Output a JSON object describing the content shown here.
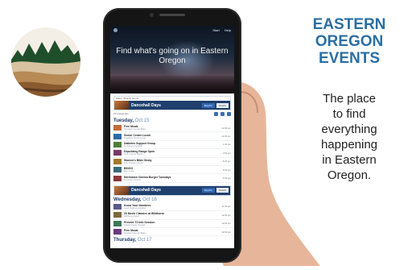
{
  "logo_icon": "forest-landscape-icon",
  "app": {
    "brand": "",
    "nav": [
      "Start",
      "Help"
    ],
    "hero_title": "Find what's going on in Eastern Oregon"
  },
  "featured": {
    "bar_label": "Sales: Shopify Gems",
    "title": "Dancehall Days",
    "primary_button": "Buy/Tix",
    "secondary_button": "Details"
  },
  "toolbar_label": "All Categories",
  "days": [
    {
      "label": "Tuesday,",
      "date": "Oct 15",
      "events": [
        {
          "title": "Free Meals",
          "sub": "Sandwich Sunrise Baker...",
          "time": "12:00 pm"
        },
        {
          "title": "Senior Center Lunch",
          "sub": "Pendleton Senior Center",
          "time": "12:00 pm"
        },
        {
          "title": "Diabetes Support Group",
          "sub": "St. Anthony Hospital",
          "time": "1:00 pm"
        },
        {
          "title": "Deputizing Range Open",
          "sub": "Union County Sheriff",
          "time": "3:00 pm"
        },
        {
          "title": "Women's Bible Study",
          "sub": "First Christian Church",
          "time": "6:00 pm"
        },
        {
          "title": "BINGO",
          "sub": "Elks Lodge",
          "time": "6:00 pm"
        },
        {
          "title": "Hermiston Cinema Burger Tuesdays",
          "sub": "Hermiston Cinema",
          "time": "6:00 pm"
        }
      ]
    },
    {
      "label": "Wednesday,",
      "date": "Oct 16",
      "events": [
        {
          "title": "Know Your Numbers",
          "sub": "Good Shepherd Medical",
          "time": "11:00 am"
        },
        {
          "title": "20 Movie Classics at Wildhorse",
          "sub": "Wildhorse Resort",
          "time": "12:00 pm"
        },
        {
          "title": "Prevent T2 Info Session",
          "sub": "Grande Ronde Hospital",
          "time": "12:00 pm"
        },
        {
          "title": "Free Meals",
          "sub": "Sandwich Sunrise Baker...",
          "time": "12:00 pm"
        }
      ]
    },
    {
      "label": "Thursday,",
      "date": "Oct 17",
      "events": []
    }
  ],
  "heading": [
    "EASTERN",
    "OREGON",
    "EVENTS"
  ],
  "tagline": [
    "The place",
    "to find",
    "everything",
    "happening",
    "in Eastern",
    "Oregon."
  ]
}
